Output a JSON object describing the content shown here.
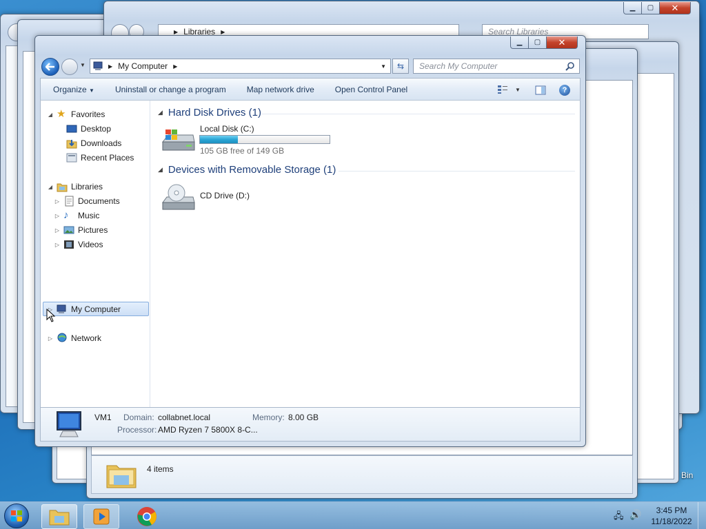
{
  "main_window": {
    "breadcrumb": "My Computer",
    "search_placeholder": "Search My Computer",
    "toolbar": {
      "organize": "Organize",
      "uninstall": "Uninstall or change a program",
      "map_drive": "Map network drive",
      "control_panel": "Open Control Panel"
    },
    "nav": {
      "favorites": "Favorites",
      "desktop": "Desktop",
      "downloads": "Downloads",
      "recent": "Recent Places",
      "libraries": "Libraries",
      "documents": "Documents",
      "music": "Music",
      "pictures": "Pictures",
      "videos": "Videos",
      "computer": "My Computer",
      "network": "Network"
    },
    "groups": {
      "hdd_title": "Hard Disk Drives (1)",
      "removable_title": "Devices with Removable Storage (1)"
    },
    "drives": {
      "c_name": "Local Disk (C:)",
      "c_free": "105 GB free of 149 GB",
      "c_used_fraction": 0.295,
      "d_name": "CD Drive (D:)"
    },
    "details": {
      "name": "VM1",
      "domain_label": "Domain:",
      "domain_value": "collabnet.local",
      "memory_label": "Memory:",
      "memory_value": "8.00 GB",
      "processor_label": "Processor:",
      "processor_value": "AMD Ryzen 7 5800X 8-C..."
    }
  },
  "back_window": {
    "breadcrumb": "Libraries",
    "search_placeholder": "Search Libraries",
    "items_count": "4 items"
  },
  "desktop": {
    "recycle_label": "Bin"
  },
  "taskbar": {
    "time": "3:45 PM",
    "date": "11/18/2022"
  },
  "colors": {
    "accent": "#1e3f7a",
    "progress": "#2ba6d6",
    "close_button": "#c4432b"
  }
}
